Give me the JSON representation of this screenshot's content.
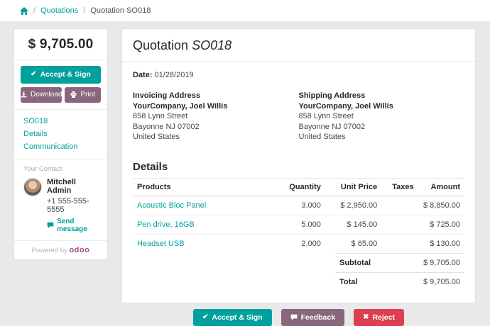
{
  "colors": {
    "teal": "#00A09D",
    "purple": "#8a667e",
    "red": "#DC3F51",
    "brand_logo": "#a24689"
  },
  "icons": {
    "check": "✔",
    "close": "✖",
    "separator": "/"
  },
  "breadcrumb": {
    "link": "Quotations",
    "current": "Quotation SO018"
  },
  "sidebar": {
    "amount_total": "$ 9,705.00",
    "accept_button": "Accept & Sign",
    "download_button": "Download",
    "print_button": "Print",
    "nav": [
      {
        "label": "SO018"
      },
      {
        "label": "Details"
      },
      {
        "label": "Communication"
      }
    ],
    "contact": {
      "section_label": "Your Contact",
      "name": "Mitchell Admin",
      "phone": "+1 555-555-5555",
      "send_message": "Send message"
    },
    "powered_by": "Powered by",
    "brand": "odoo"
  },
  "main": {
    "title_prefix": "Quotation",
    "title_ref": "SO018",
    "date_label": "Date:",
    "date_value": "01/28/2019",
    "invoicing": {
      "heading": "Invoicing Address",
      "name": "YourCompany, Joel Willis",
      "street": "858 Lynn Street",
      "city": "Bayonne NJ 07002",
      "country": "United States"
    },
    "shipping": {
      "heading": "Shipping Address",
      "name": "YourCompany, Joel Willis",
      "street": "858 Lynn Street",
      "city": "Bayonne NJ 07002",
      "country": "United States"
    },
    "details": {
      "heading": "Details",
      "columns": [
        "Products",
        "Quantity",
        "Unit Price",
        "Taxes",
        "Amount"
      ],
      "rows": [
        {
          "product": "Acoustic Bloc Panel",
          "quantity": "3.000",
          "unit_price": "$ 2,950.00",
          "taxes": "",
          "amount": "$ 8,850.00"
        },
        {
          "product": "Pen drive, 16GB",
          "quantity": "5.000",
          "unit_price": "$ 145.00",
          "taxes": "",
          "amount": "$ 725.00"
        },
        {
          "product": "Headset USB",
          "quantity": "2.000",
          "unit_price": "$ 65.00",
          "taxes": "",
          "amount": "$ 130.00"
        }
      ],
      "totals": [
        {
          "label": "Subtotal",
          "value": "$ 9,705.00"
        },
        {
          "label": "Total",
          "value": "$ 9,705.00"
        }
      ]
    }
  },
  "footer_actions": {
    "accept": "Accept & Sign",
    "feedback": "Feedback",
    "reject": "Reject"
  }
}
